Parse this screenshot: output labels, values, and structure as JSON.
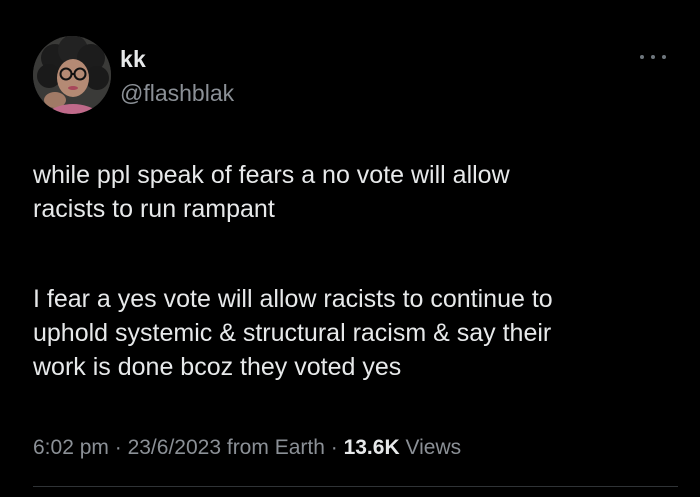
{
  "author": {
    "display_name": "kk",
    "handle": "@flashblak",
    "avatar_icon": "profile-photo"
  },
  "more_icon": "more-dots-icon",
  "tweet": {
    "paragraph_1": "while ppl speak of fears a no vote will allow\nracists to run rampant",
    "paragraph_2": "I fear a yes vote will allow racists to continue to\nuphold systemic & structural racism & say their\nwork is done bcoz they voted yes"
  },
  "meta": {
    "time": "6:02 pm",
    "date": "23/6/2023",
    "source": "from Earth",
    "separator": "·",
    "views_count": "13.6K",
    "views_label": "Views"
  },
  "colors": {
    "background": "#000000",
    "text_primary": "#e7e9ea",
    "text_secondary": "#8b9096"
  }
}
